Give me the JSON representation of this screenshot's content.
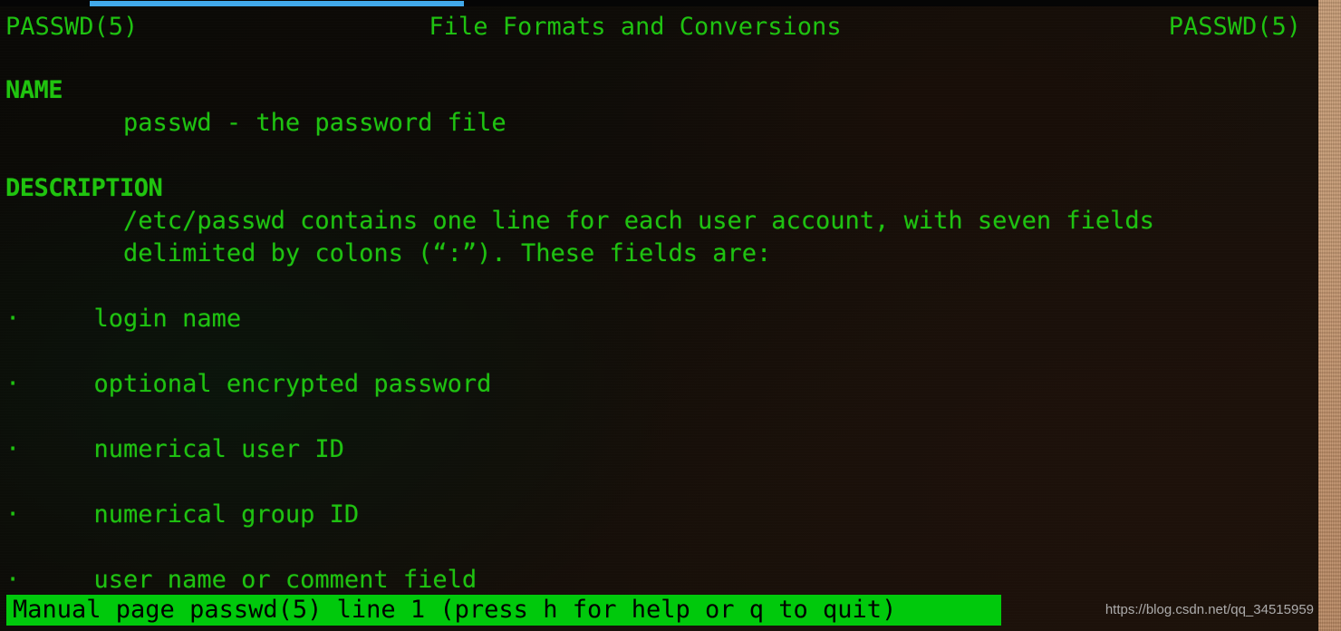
{
  "window": {
    "kind": "terminal-man-page",
    "background_color": "#140d09"
  },
  "progress_bar": {
    "name": "blue-progress-bar",
    "color": "#41a9ea",
    "track_color": "#050505"
  },
  "manpage": {
    "header": {
      "left": "PASSWD(5)",
      "center": "File Formats and Conversions",
      "right": "PASSWD(5)"
    },
    "sections": [
      {
        "heading": "NAME",
        "lines": [
          "        passwd - the password file"
        ]
      },
      {
        "heading": "DESCRIPTION",
        "lines": [
          "        /etc/passwd contains one line for each user account, with seven fields",
          "        delimited by colons (“:”). These fields are:"
        ]
      }
    ],
    "bullets": [
      "·     login name",
      "·     optional encrypted password",
      "·     numerical user ID",
      "·     numerical group ID",
      "·     user name or comment field"
    ],
    "text_color": "#1fc211"
  },
  "status_bar": {
    "text": "Manual page passwd(5) line 1 (press h for help or q to quit)",
    "background_color": "#00c90c",
    "text_color": "#000000"
  },
  "watermark": {
    "text": "https://blog.csdn.net/qq_34515959",
    "color": "#b9b9b9"
  }
}
